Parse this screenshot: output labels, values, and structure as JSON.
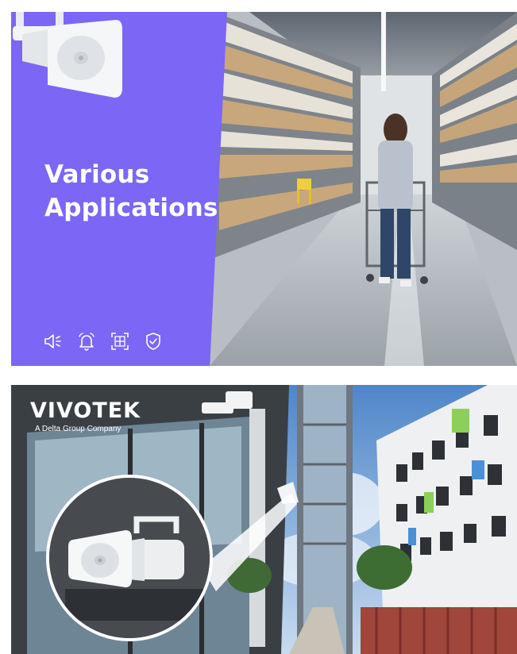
{
  "top_panel": {
    "headline_line1": "Various",
    "headline_line2": "Applications",
    "accent_color": "#7b66f6",
    "feature_icons": [
      "speaker-icon",
      "bell-icon",
      "scan-frame-icon",
      "shield-check-icon"
    ],
    "product_image": "horn-speaker-icon",
    "scene": "warehouse-aisle-photo"
  },
  "bottom_panel": {
    "brand_name": "VIVOTEK",
    "brand_tagline": "A Delta Group Company",
    "scene": "building-exterior-photo",
    "product_image": "horn-speaker-icon"
  }
}
